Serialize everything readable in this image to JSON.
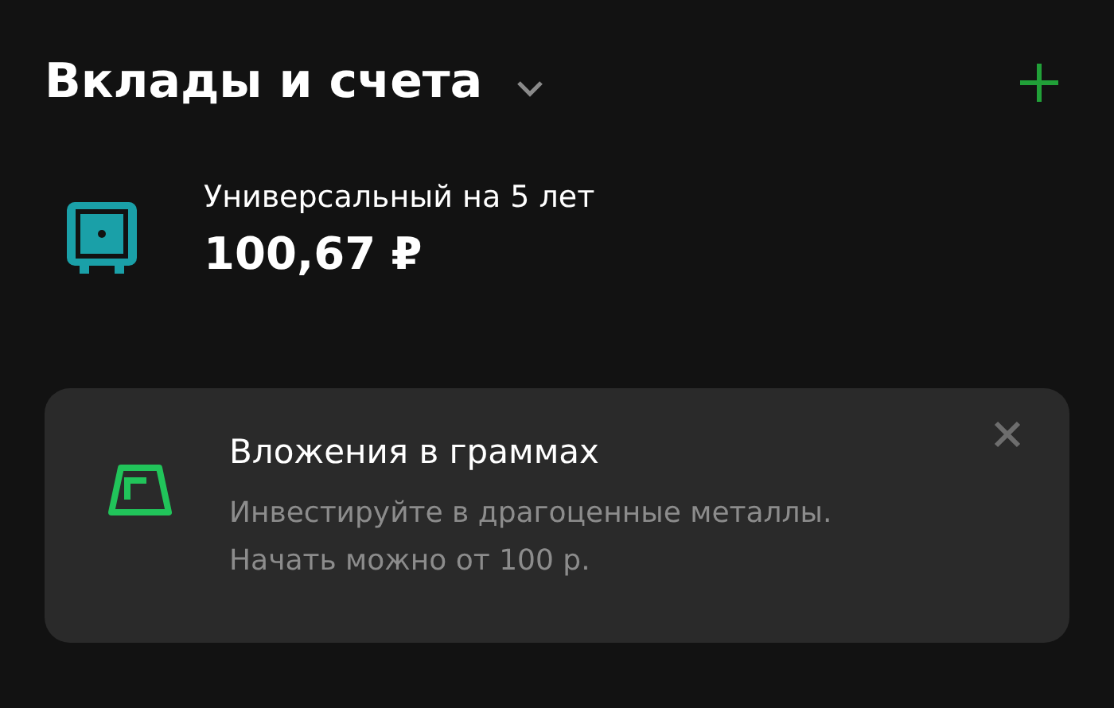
{
  "header": {
    "title": "Вклады и счета"
  },
  "accounts": [
    {
      "name": "Универсальный на 5 лет",
      "balance": "100,67 ₽"
    }
  ],
  "promo": {
    "title": "Вложения в граммах",
    "text": "Инвестируйте в драгоценные металлы. Начать можно от 100 р."
  }
}
